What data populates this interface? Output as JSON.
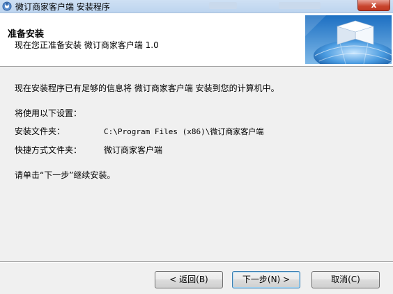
{
  "window": {
    "title": "微订商家客户端 安装程序",
    "close_label": "x",
    "icon": "installer-app-icon"
  },
  "header": {
    "title": "准备安装",
    "subtitle": "现在您正准备安装 微订商家客户端 1.0",
    "graphic_icon": "globe-box-graphic"
  },
  "body": {
    "intro": "现在安装程序已有足够的信息将 微订商家客户端 安装到您的计算机中。",
    "settings_heading": "将使用以下设置：",
    "install_folder_label": "安装文件夹：",
    "install_folder_value": "C:\\Program Files (x86)\\微订商家客户端",
    "shortcut_folder_label": "快捷方式文件夹：",
    "shortcut_folder_value": "微订商家客户端",
    "instruction": "请单击“下一步”继续安装。"
  },
  "buttons": {
    "back": "< 返回(B)",
    "next": "下一步(N) >",
    "cancel": "取消(C)"
  },
  "colors": {
    "dialog_bg": "#f0f0f0",
    "header_bg": "#ffffff",
    "titlebar": "#bcd4ef",
    "close_button": "#c8442d"
  }
}
